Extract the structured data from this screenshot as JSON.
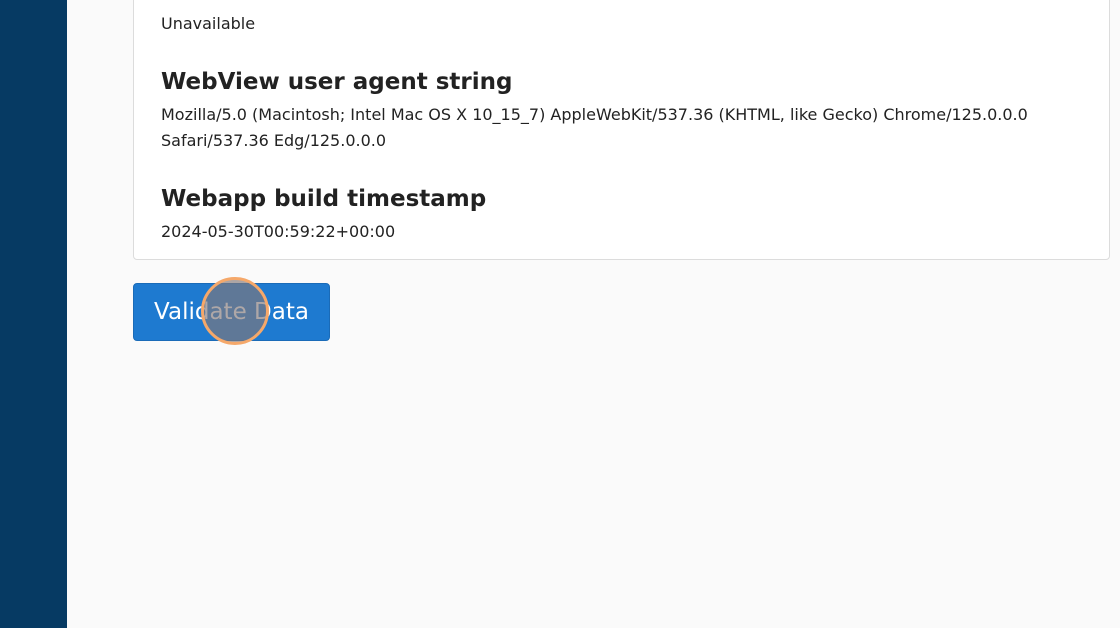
{
  "sidebar": {},
  "card": {
    "partial_heading": "",
    "sections": [
      {
        "heading": "",
        "value": "Unavailable"
      },
      {
        "heading": "WebView user agent string",
        "value": "Mozilla/5.0 (Macintosh; Intel Mac OS X 10_15_7) AppleWebKit/537.36 (KHTML, like Gecko) Chrome/125.0.0.0 Safari/537.36 Edg/125.0.0.0"
      },
      {
        "heading": "Webapp build timestamp",
        "value": "2024-05-30T00:59:22+00:00"
      }
    ]
  },
  "actions": {
    "validate_label": "Validate Data"
  },
  "colors": {
    "sidebar": "#063a63",
    "primary_button": "#1e7ad0",
    "click_ring": "#f5a86a"
  }
}
